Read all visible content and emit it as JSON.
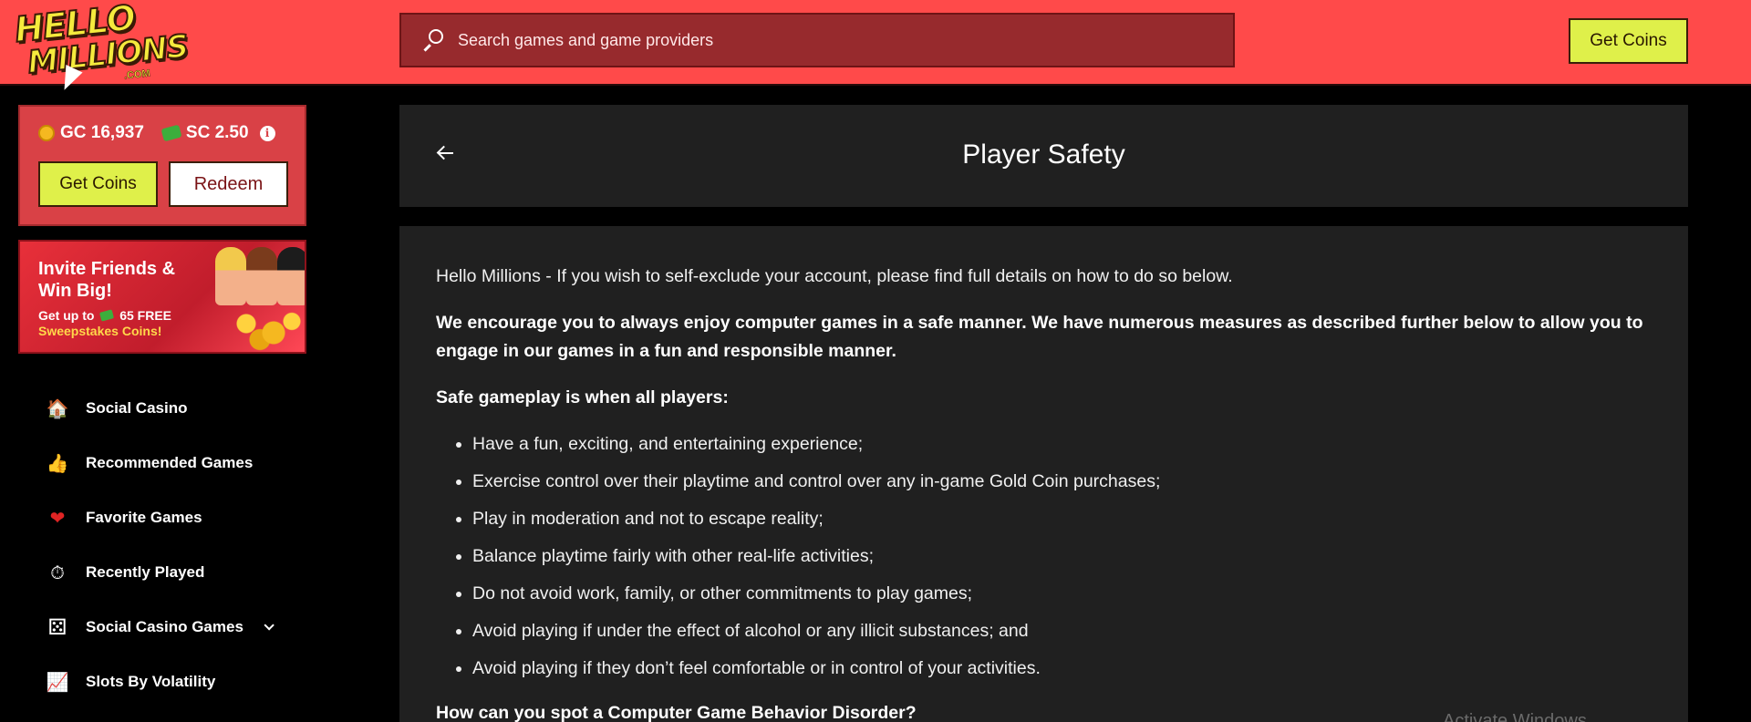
{
  "header": {
    "logo_line1": "HELLO",
    "logo_line2": "MILLIONS",
    "logo_suffix": ".COM",
    "search_placeholder": "Search games and game providers",
    "get_coins_label": "Get Coins"
  },
  "wallet": {
    "gc_label": "GC 16,937",
    "sc_label": "SC 2.50",
    "info_glyph": "i",
    "get_coins_label": "Get Coins",
    "redeem_label": "Redeem"
  },
  "promo": {
    "title": "Invite Friends & Win Big!",
    "line1_prefix": "Get up to",
    "line1_suffix": "65 FREE",
    "line2": "Sweepstakes Coins!"
  },
  "sidebar": {
    "items": [
      {
        "label": "Social Casino",
        "icon": "house-icon",
        "glyph": "🏠"
      },
      {
        "label": "Recommended Games",
        "icon": "thumbs-up-icon",
        "glyph": "👍"
      },
      {
        "label": "Favorite Games",
        "icon": "heart-icon",
        "glyph": "❤"
      },
      {
        "label": "Recently Played",
        "icon": "stopwatch-icon",
        "glyph": "⏱"
      },
      {
        "label": "Social Casino Games",
        "icon": "dice-icon",
        "glyph": "⚄"
      },
      {
        "label": "Slots By Volatility",
        "icon": "chart-up-icon",
        "glyph": "📈"
      }
    ]
  },
  "main": {
    "title": "Player Safety",
    "intro": "Hello Millions - If you wish to self-exclude your account, please find full details on how to do so below.",
    "encourage": "We encourage you to always enjoy computer games in a safe manner. We have numerous measures as described further below to allow you to engage in our games in a fun and responsible manner.",
    "safe_heading": "Safe gameplay is when all players:",
    "bullets": [
      "Have a fun, exciting, and entertaining experience;",
      "Exercise control over their playtime and control over any in-game Gold Coin purchases;",
      "Play in moderation and not to escape reality;",
      "Balance playtime fairly with other real-life activities;",
      "Do not avoid work, family, or other commitments to play games;",
      "Avoid playing if under the effect of alcohol or any illicit substances; and",
      "Avoid playing if they don’t feel comfortable or in control of your activities."
    ],
    "next_heading": "How can you spot a Computer Game Behavior Disorder?",
    "watermark": "Activate Windows"
  },
  "colors": {
    "header_bg": "#ff4a4a",
    "search_bg": "#972a2d",
    "accent_yellow": "#dff04a",
    "wallet_bg": "#d94146",
    "card_bg": "#202020",
    "page_bg": "#000000"
  }
}
